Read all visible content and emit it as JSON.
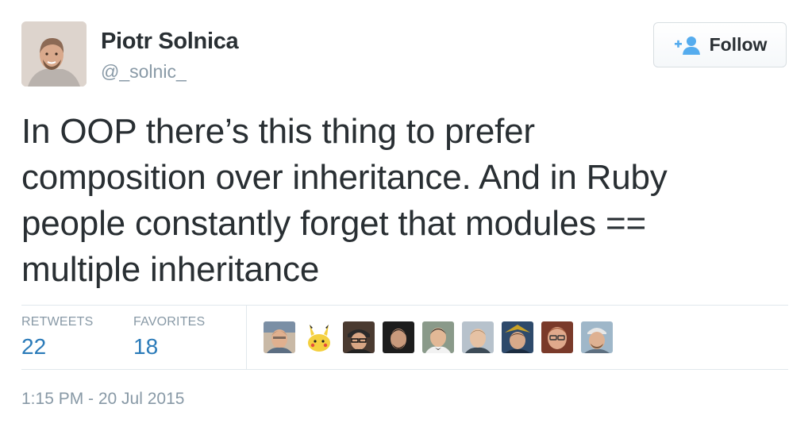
{
  "tweet": {
    "author": {
      "display_name": "Piotr Solnica",
      "screen_name": "@_solnic_",
      "avatar_icon": "profile-photo"
    },
    "follow_button": {
      "label": "Follow",
      "icon": "add-person-icon",
      "icon_color": "#55acee"
    },
    "text_lines": [
      "In OOP there’s this thing to prefer",
      "composition over inheritance. And in Ruby",
      "people constantly forget that modules ==",
      "multiple inheritance"
    ],
    "stats": {
      "retweets_label": "RETWEETS",
      "retweets_count": "22",
      "favorites_label": "FAVORITES",
      "favorites_count": "18"
    },
    "favoriters": [
      {
        "icon": "user-avatar-1"
      },
      {
        "icon": "pikachu-avatar"
      },
      {
        "icon": "user-avatar-3"
      },
      {
        "icon": "user-avatar-4"
      },
      {
        "icon": "user-avatar-5"
      },
      {
        "icon": "user-avatar-6"
      },
      {
        "icon": "user-avatar-7"
      },
      {
        "icon": "user-avatar-8"
      },
      {
        "icon": "user-avatar-9"
      }
    ],
    "timestamp": "1:15 PM - 20 Jul 2015",
    "colors": {
      "text": "#292f33",
      "muted": "#8899a6",
      "count": "#2b7bb9",
      "divider": "#e1e8ed"
    }
  }
}
